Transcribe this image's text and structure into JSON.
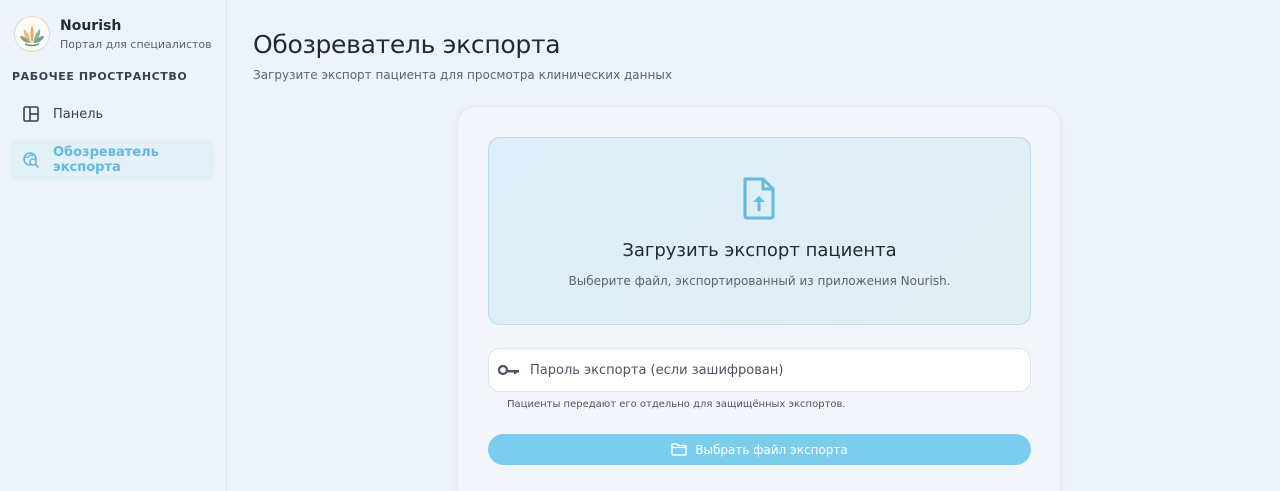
{
  "brand": {
    "name": "Nourish",
    "subtitle": "Портал для специалистов"
  },
  "sidebar": {
    "section_title": "РАБОЧЕЕ ПРОСТРАНСТВО",
    "items": [
      {
        "label": "Панель",
        "icon": "dashboard-layout-icon",
        "active": false
      },
      {
        "label": "Обозреватель экспорта",
        "icon": "globe-search-icon",
        "active": true
      }
    ]
  },
  "page": {
    "title": "Обозреватель экспорта",
    "subtitle": "Загрузите экспорт пациента для просмотра клинических данных"
  },
  "upload": {
    "icon": "file-upload-icon",
    "title": "Загрузить экспорт пациента",
    "subtitle": "Выберите файл, экспортированный из приложения Nourish."
  },
  "password": {
    "icon": "key-icon",
    "placeholder": "Пароль экспорта (если зашифрован)",
    "value": "",
    "hint": "Пациенты передают его отдельно для защищённых экспортов."
  },
  "choose_button": {
    "icon": "folder-icon",
    "label": "Выбрать файл экспорта"
  },
  "colors": {
    "accent": "#63b9de",
    "button": "#7bcdee",
    "background": "#eef3f9"
  }
}
